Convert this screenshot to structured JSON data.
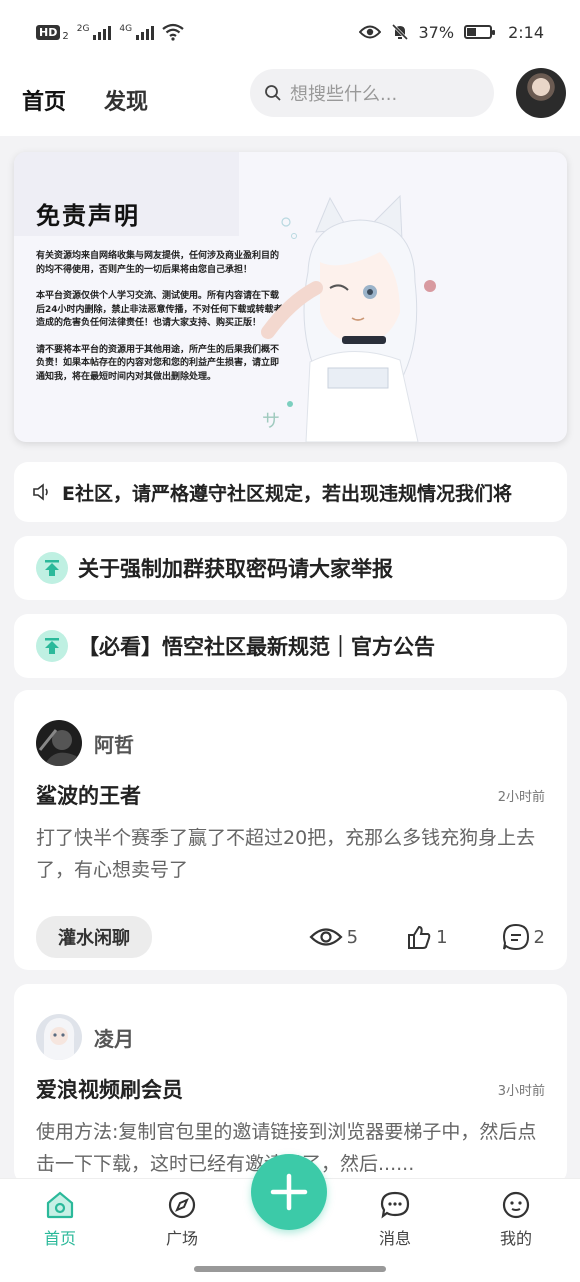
{
  "status_bar": {
    "hd": "HD",
    "hd_sub": "2",
    "sig1": "2G",
    "sig2": "4G",
    "battery": "37%",
    "time": "2:14"
  },
  "header": {
    "tabs": [
      {
        "label": "首页"
      },
      {
        "label": "发现"
      }
    ],
    "search_placeholder": "想搜些什么..."
  },
  "banner": {
    "title": "免责声明",
    "paragraphs": [
      "有关资源均来自网络收集与网友提供，任何涉及商业盈利目的的均不得使用，否则产生的一切后果将由您自己承担！",
      "本平台资源仅供个人学习交流、测试使用。所有内容请在下载后24小时内删除，禁止非法恶意传播，不对任何下载或转载者造成的危害负任何法律责任！也请大家支持、购买正版！",
      "请不要将本平台的资源用于其他用途，所产生的后果我们概不负责！如果本帖存在的内容对您和您的利益产生损害，请立即通知我，将在最短时间内对其做出删除处理。"
    ]
  },
  "marquee": {
    "text": "E社区，请严格遵守社区规定，若出现违规情况我们将"
  },
  "notices": [
    {
      "text": "关于强制加群获取密码请大家举报"
    },
    {
      "text": "【必看】悟空社区最新规范｜官方公告"
    }
  ],
  "posts": [
    {
      "author": "阿哲",
      "title": "鲨波的王者",
      "time": "2小时前",
      "body": "打了快半个赛季了赢了不超过20把，充那么多钱充狗身上去了，有心想卖号了",
      "tag": "灌水闲聊",
      "views": "5",
      "likes": "1",
      "comments": "2"
    },
    {
      "author": "凌月",
      "title": "爱浪视频刷会员",
      "time": "3小时前",
      "body": "使用方法:复制官包里的邀请链接到浏览器要梯子中，然后点击一下下载，这时已经有邀请码了，然后......"
    }
  ],
  "bottom_nav": [
    {
      "label": "首页"
    },
    {
      "label": "广场"
    },
    {
      "label": "消息"
    },
    {
      "label": "我的"
    }
  ],
  "colors": {
    "accent": "#3ccaa8"
  }
}
